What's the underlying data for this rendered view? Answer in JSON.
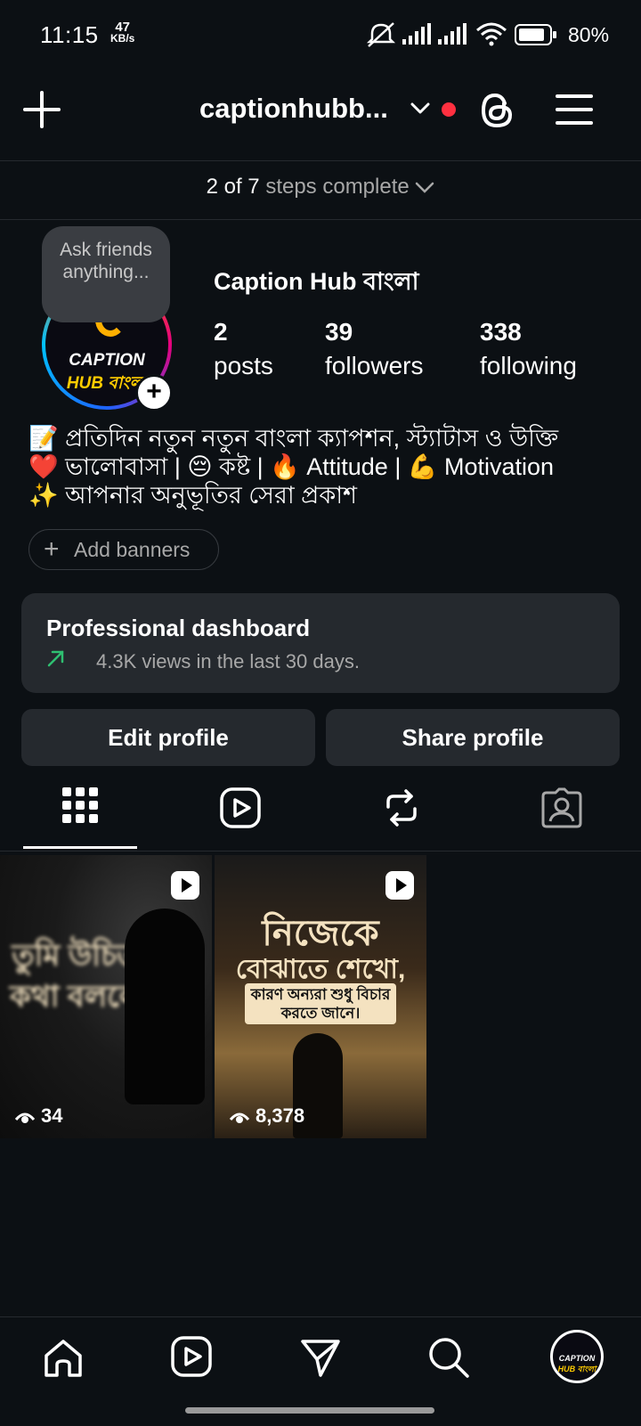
{
  "status_bar": {
    "time": "11:15",
    "net_speed_value": "47",
    "net_speed_unit": "KB/s",
    "battery_pct": "80%"
  },
  "top_bar": {
    "username": "captionhubb...",
    "icons": [
      "plus-icon",
      "chevron-down-icon",
      "threads-icon",
      "menu-icon"
    ]
  },
  "steps": {
    "count": "2 of 7",
    "label": "steps complete"
  },
  "profile": {
    "note_bubble": "Ask friends anything...",
    "avatar_text_1": "CAPTION",
    "avatar_text_2": "HUB বাংলা",
    "display_name": "Caption Hub বাংলা",
    "stats": [
      {
        "value": "2",
        "label": "posts"
      },
      {
        "value": "39",
        "label": "followers"
      },
      {
        "value": "338",
        "label": "following"
      }
    ],
    "bio": [
      "📝 প্রতিদিন নতুন নতুন বাংলা ক্যাপশন, স্ট্যাটাস ও উক্তি",
      "❤️ ভালোবাসা | 😔 কষ্ট | 🔥 Attitude | 💪 Motivation",
      "✨ আপনার অনুভূতির সেরা প্রকাশ"
    ]
  },
  "add_banners_label": "Add banners",
  "dashboard": {
    "title": "Professional dashboard",
    "subtitle": "4.3K views in the last 30 days."
  },
  "buttons": {
    "edit_profile": "Edit profile",
    "share_profile": "Share profile"
  },
  "tabs": [
    "grid-icon",
    "reels-icon",
    "reposts-icon",
    "tagged-icon"
  ],
  "posts": [
    {
      "views": "34",
      "overlay": "তুমি উচিত কথা বললে"
    },
    {
      "views": "8,378",
      "overlay_1": "নিজেকে",
      "overlay_2": "বোঝাতে শেখো,",
      "overlay_3": "কারণ অন্যরা শুধু বিচার করতে জানে।"
    }
  ],
  "bottom_nav": [
    "home-icon",
    "reels-icon",
    "send-icon",
    "search-icon",
    "profile-avatar"
  ],
  "colors": {
    "background": "#0c1014",
    "card": "#25292e",
    "accent_red": "#ff3040",
    "trend_green": "#2fbf71"
  }
}
